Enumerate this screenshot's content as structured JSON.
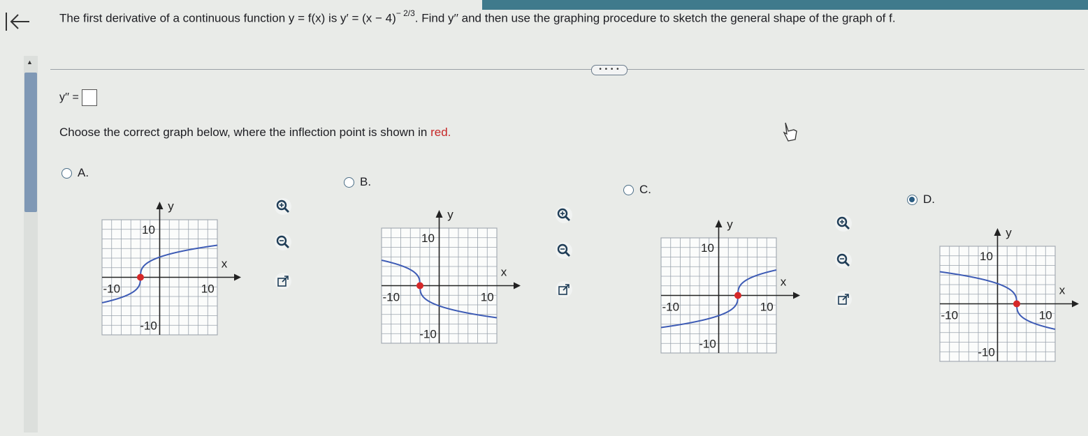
{
  "question": {
    "prefix": "The first derivative of a continuous function y = f(x) is y′ = (x − 4)",
    "exponent": "− 2/3",
    "suffix": ". Find y′′ and then use the graphing procedure to sketch the general shape of the graph of f."
  },
  "expand_label": "• • • •",
  "answer": {
    "label": "y′′ =",
    "value": ""
  },
  "choose": {
    "text": "Choose the correct graph below, where the inflection point is shown in ",
    "red_word": "red."
  },
  "options": [
    {
      "label": "A.",
      "selected": false
    },
    {
      "label": "B.",
      "selected": false
    },
    {
      "label": "C.",
      "selected": false
    },
    {
      "label": "D.",
      "selected": true
    }
  ],
  "graph_labels": {
    "x": "x",
    "y": "y",
    "xmin": "-10",
    "xmax": "10",
    "ymax": "10",
    "ymin": "-10"
  },
  "colors": {
    "curve": "#3d5bb5",
    "inflection": "#d62828",
    "topbar": "#3f7a8c",
    "selected_radio": "#2b5d82"
  },
  "icons": [
    "back-arrow-icon",
    "zoom-in-icon",
    "zoom-out-icon",
    "open-new-window-icon"
  ]
}
